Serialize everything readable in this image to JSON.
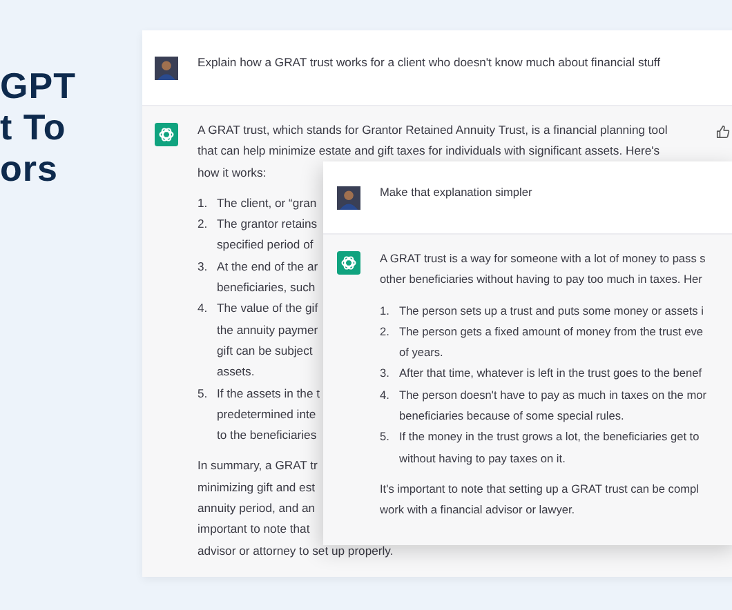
{
  "headline": {
    "lines": [
      "GPT",
      "t To",
      "ors"
    ]
  },
  "back_chat": {
    "messages": [
      {
        "kind": "user",
        "blocks": [
          {
            "kind": "paragraph",
            "lines": [
              "Explain how a GRAT trust works for a client who doesn't know much about financial stuff"
            ]
          }
        ]
      },
      {
        "kind": "assistant",
        "blocks": [
          {
            "kind": "paragraph",
            "lines": [
              "A GRAT trust, which stands for Grantor Retained Annuity Trust, is a financial planning tool",
              "that can help minimize estate and gift taxes for individuals with significant assets. Here's",
              "how it works:"
            ]
          },
          {
            "kind": "list",
            "items": [
              {
                "number": "1.",
                "lines": [
                  "The client, or “gran"
                ]
              },
              {
                "number": "2.",
                "lines": [
                  "The grantor retains",
                  "specified period of"
                ]
              },
              {
                "number": "3.",
                "lines": [
                  "At the end of the ar",
                  "beneficiaries, such"
                ]
              },
              {
                "number": "4.",
                "lines": [
                  "The value of the gif",
                  "the annuity paymer",
                  "gift can be subject",
                  "assets."
                ]
              },
              {
                "number": "5.",
                "lines": [
                  "If the assets in the t",
                  "predetermined inte",
                  "to the beneficiaries"
                ]
              }
            ]
          },
          {
            "kind": "paragraph",
            "lines": [
              "In summary, a GRAT tr",
              "minimizing gift and est",
              "annuity period, and an",
              "important to note that",
              "advisor or attorney to set up properly."
            ]
          }
        ]
      }
    ]
  },
  "front_chat": {
    "messages": [
      {
        "kind": "user",
        "blocks": [
          {
            "kind": "paragraph",
            "lines": [
              "Make that explanation simpler"
            ]
          }
        ]
      },
      {
        "kind": "assistant",
        "blocks": [
          {
            "kind": "paragraph",
            "lines": [
              "A GRAT trust is a way for someone with a lot of money to pass s",
              "other beneficiaries without having to pay too much in taxes. Her"
            ]
          },
          {
            "kind": "list",
            "items": [
              {
                "number": "1.",
                "lines": [
                  "The person sets up a trust and puts some money or assets i"
                ]
              },
              {
                "number": "2.",
                "lines": [
                  "The person gets a fixed amount of money from the trust eve",
                  "of years."
                ]
              },
              {
                "number": "3.",
                "lines": [
                  "After that time, whatever is left in the trust goes to the benef"
                ]
              },
              {
                "number": "4.",
                "lines": [
                  "The person doesn't have to pay as much in taxes on the mor",
                  "beneficiaries because of some special rules."
                ]
              },
              {
                "number": "5.",
                "lines": [
                  "If the money in the trust grows a lot, the beneficiaries get to",
                  "without having to pay taxes on it."
                ]
              }
            ]
          },
          {
            "kind": "paragraph",
            "lines": [
              "It's important to note that setting up a GRAT trust can be compl",
              "work with a financial advisor or lawyer."
            ]
          }
        ]
      }
    ]
  }
}
